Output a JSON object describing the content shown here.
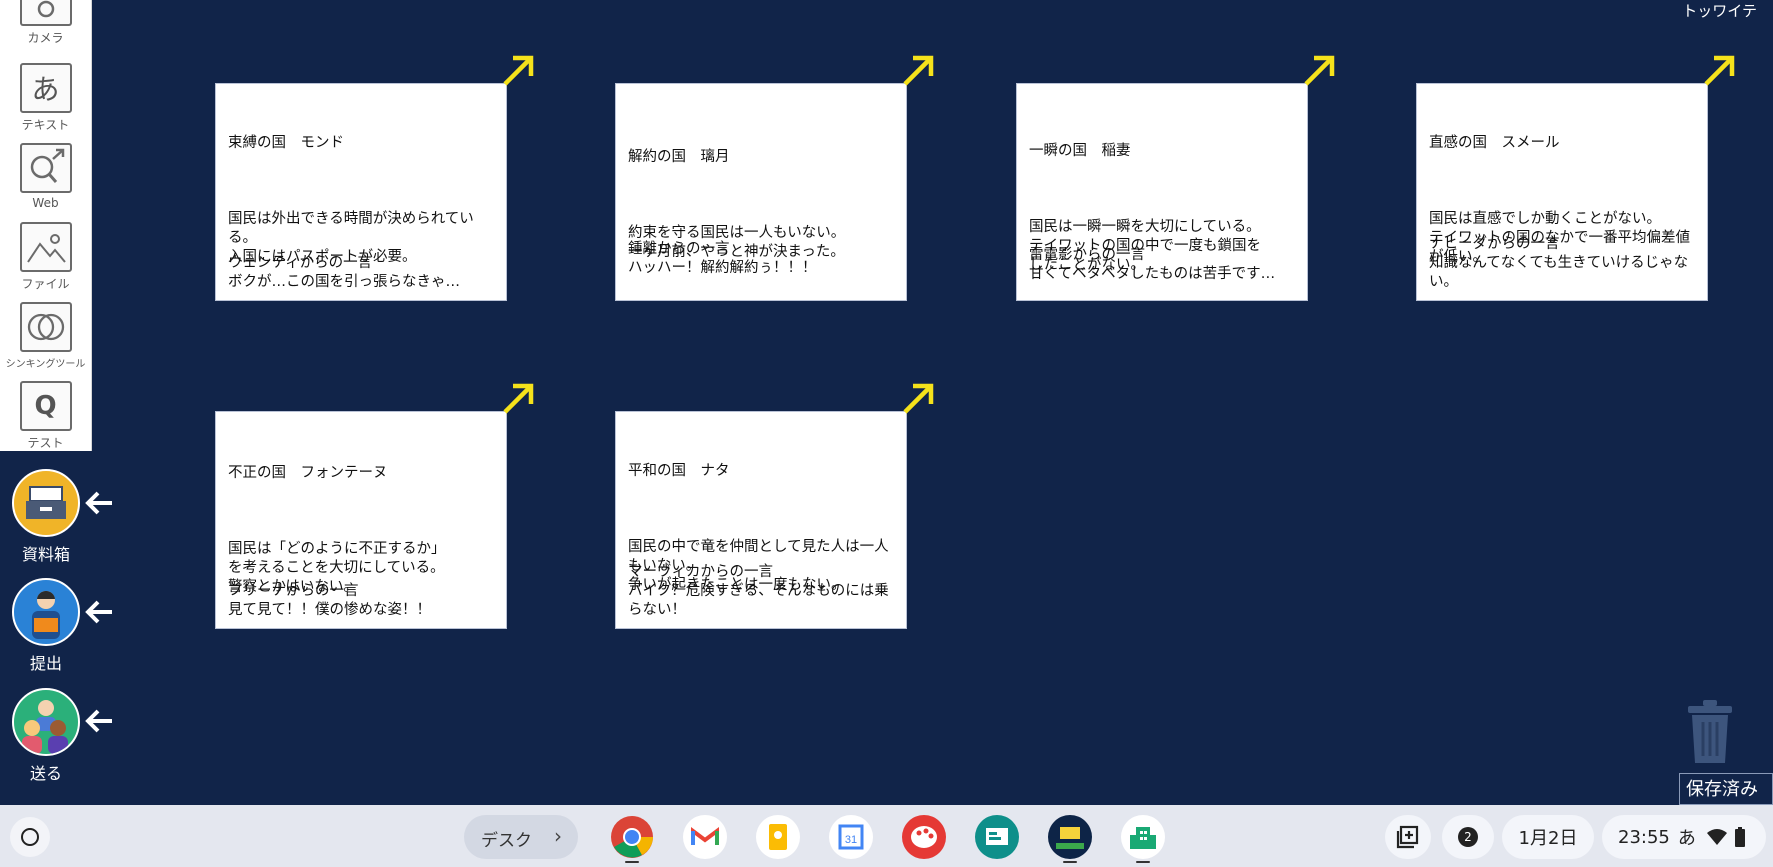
{
  "top_right_text": "トッワイテ",
  "palette": {
    "tools": [
      {
        "label": "カメラ",
        "icon": "camera-icon"
      },
      {
        "label": "テキスト",
        "icon": "text-icon",
        "glyph": "あ"
      },
      {
        "label": "Web",
        "icon": "web-search-icon"
      },
      {
        "label": "ファイル",
        "icon": "image-file-icon"
      },
      {
        "label": "シンキングツール",
        "icon": "thinking-tool-icon"
      },
      {
        "label": "テスト",
        "icon": "test-icon",
        "glyph": "Q"
      }
    ]
  },
  "actions": [
    {
      "label": "資料箱",
      "icon": "document-box-icon"
    },
    {
      "label": "提出",
      "icon": "submit-person-icon"
    },
    {
      "label": "送る",
      "icon": "send-people-icon"
    }
  ],
  "cards": [
    {
      "title": "束縛の国　モンド",
      "body": "国民は外出できる時間が決められている。\n入国にはパスポートが必要。",
      "footer": "ウェンティからの一言\nボクが…この国を引っ張らなきゃ…"
    },
    {
      "title": "解約の国　璃月",
      "body": "約束を守る国民は一人もいない。\n一ヶ月前、やっと神が決まった。",
      "footer": "鍾離からの一言\nハッハー！解約解約ぅ！！！"
    },
    {
      "title": "一瞬の国　稲妻",
      "body": "国民は一瞬一瞬を大切にしている。\nテイワットの国の中で一度も鎖国を\nしたことがない。",
      "footer": "雷電影からの一言\n甘くてベタベタしたものは苦手です…"
    },
    {
      "title": "直感の国　スメール",
      "body": "国民は直感でしか動くことがない。\nテイワットの国のなかで一番平均偏差値が低い。",
      "footer": "ナヒーダからの一言\n知識なんてなくても生きていけるじゃない。"
    },
    {
      "title": "不正の国　フォンテーヌ",
      "body": "国民は「どのように不正するか」\nを考えることを大切にしている。\n警察とかはいない。",
      "footer": "フリーナからの一言\n見て見て！！僕の惨めな姿！！"
    },
    {
      "title": "平和の国　ナタ",
      "body": "国民の中で竜を仲間として見た人は一人もいない。\n争いが起きたことは一度もない。",
      "footer": "マーヴィカからの一言\nバイク？危険すぎる、そんなものには乗らない！"
    }
  ],
  "saved_label": "保存済み",
  "shelf": {
    "desk_label": "デスク",
    "apps": [
      "chrome-icon",
      "gmail-icon",
      "keep-icon",
      "calendar-icon",
      "paint-icon",
      "classroom-icon",
      "school-app-icon",
      "building-app-icon"
    ],
    "notification_count": "2",
    "date": "1月2日",
    "time": "23:55",
    "ime": "あ"
  },
  "colors": {
    "background": "#112449",
    "arrow": "#f5e21b",
    "white": "#ffffff"
  }
}
